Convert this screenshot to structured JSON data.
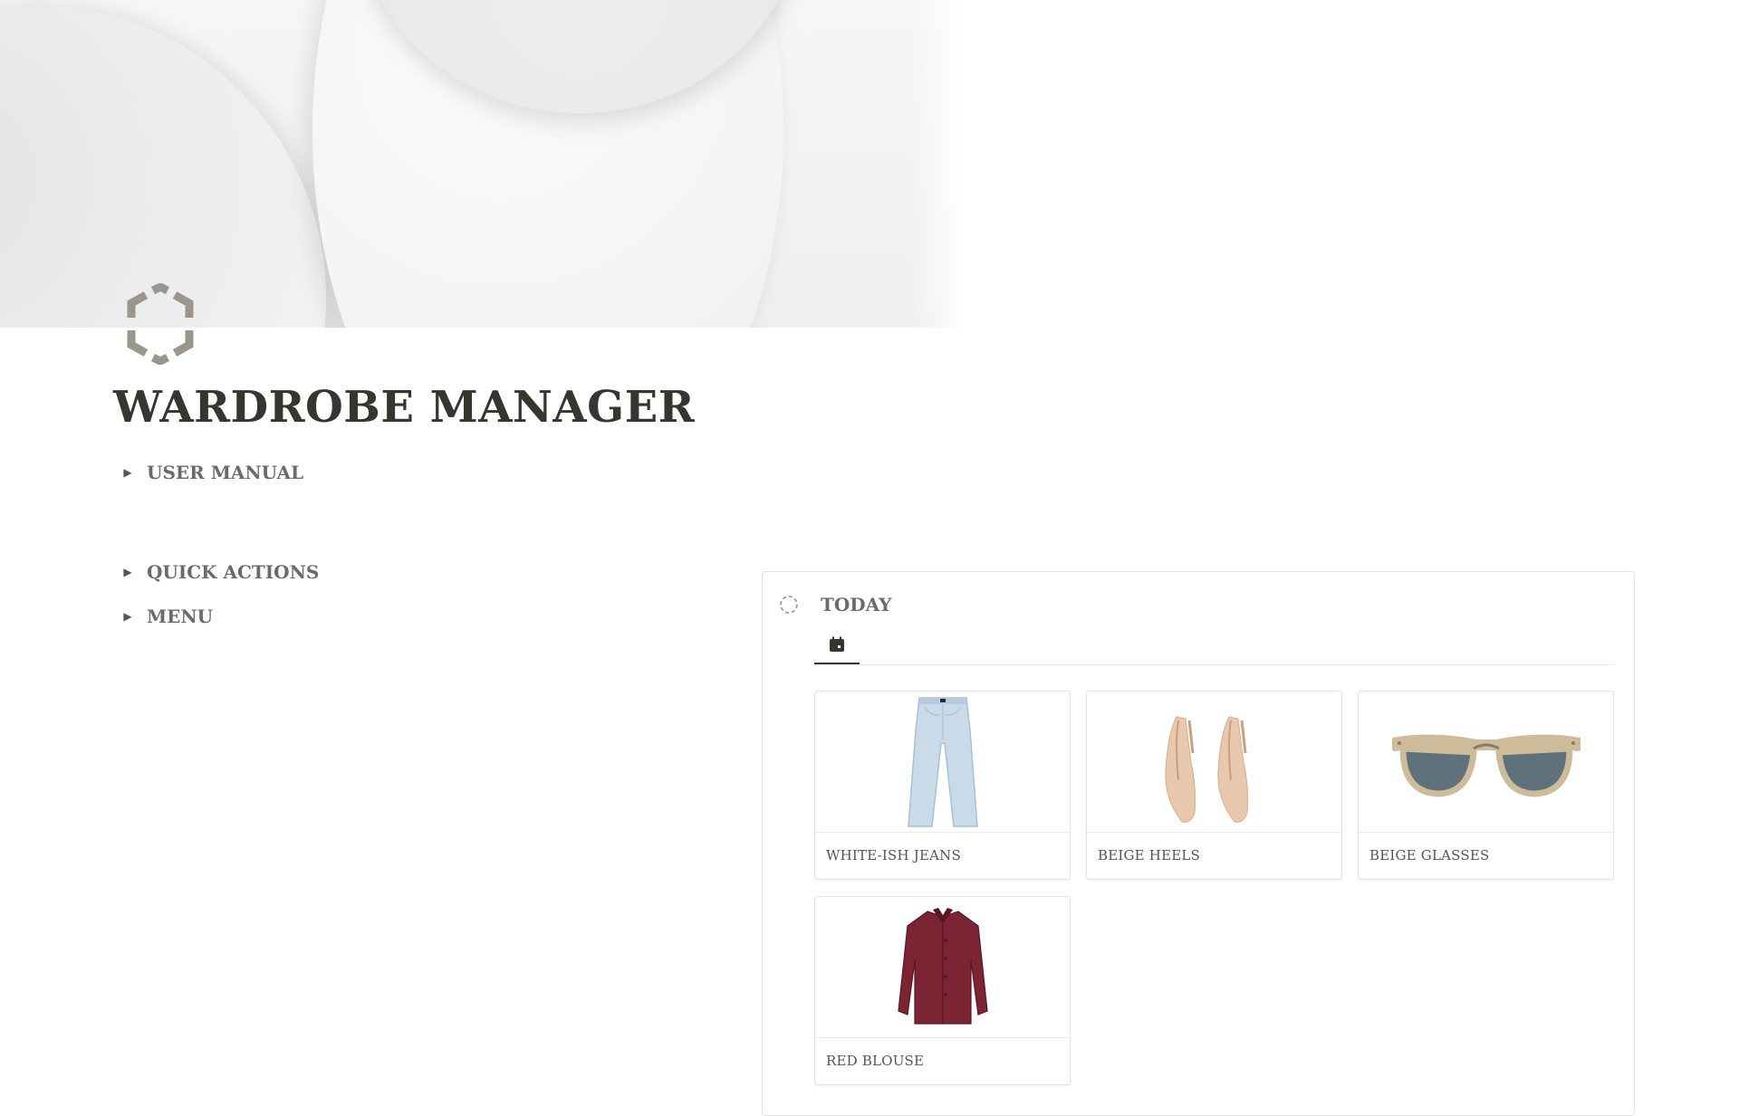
{
  "page": {
    "title": "WARDROBE MANAGER",
    "icon": "hexagon-icon"
  },
  "toggles": [
    {
      "label": "USER MANUAL"
    },
    {
      "label": "QUICK ACTIONS"
    },
    {
      "label": "MENU"
    }
  ],
  "today": {
    "title": "TODAY",
    "tab_icon": "calendar-icon",
    "cards": [
      {
        "label": "WHITE-ISH JEANS",
        "image": "jeans"
      },
      {
        "label": "BEIGE HEELS",
        "image": "heels"
      },
      {
        "label": "BEIGE GLASSES",
        "image": "sunglasses"
      },
      {
        "label": "RED BLOUSE",
        "image": "blouse"
      }
    ]
  },
  "colors": {
    "text": "#37352f",
    "muted": "#6b6b6b",
    "icon": "#9b968c",
    "blouse": "#7a2434",
    "denim": "#c9dbe8",
    "beige": "#e9c9ad"
  }
}
